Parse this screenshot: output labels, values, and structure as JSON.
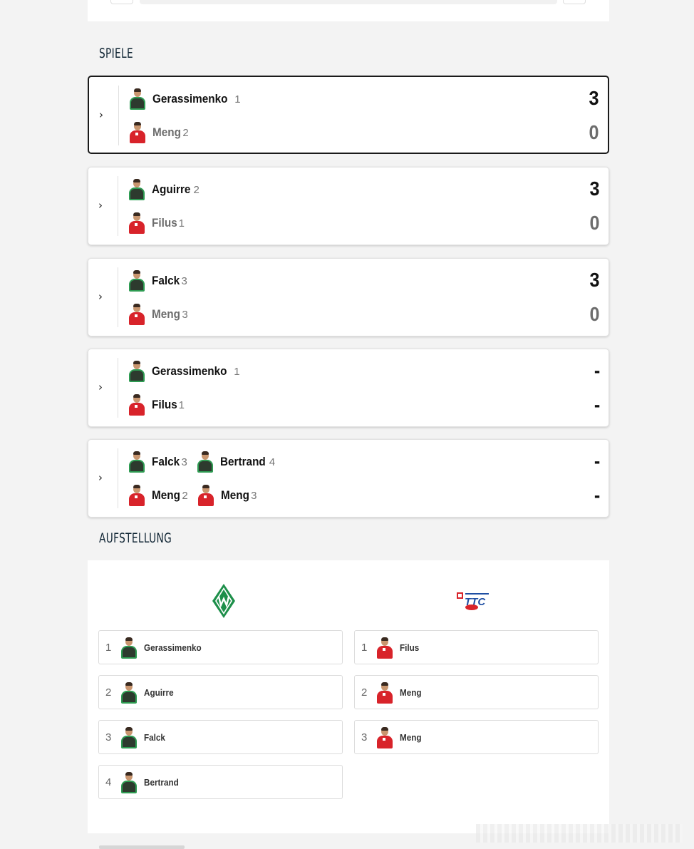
{
  "sections": {
    "spiele_title": "SPIELE",
    "aufstellung_title": "AUFSTELLUNG"
  },
  "matches": [
    {
      "top": {
        "players": [
          {
            "name": "Gerassimenko",
            "pos": "1"
          }
        ],
        "score": "3",
        "winner": true
      },
      "bottom": {
        "players": [
          {
            "name": "Meng",
            "pos": "2"
          }
        ],
        "score": "0",
        "winner": false
      },
      "selected": true
    },
    {
      "top": {
        "players": [
          {
            "name": "Aguirre",
            "pos": "2"
          }
        ],
        "score": "3",
        "winner": true
      },
      "bottom": {
        "players": [
          {
            "name": "Filus",
            "pos": "1"
          }
        ],
        "score": "0",
        "winner": false
      }
    },
    {
      "top": {
        "players": [
          {
            "name": "Falck",
            "pos": "3"
          }
        ],
        "score": "3",
        "winner": true
      },
      "bottom": {
        "players": [
          {
            "name": "Meng",
            "pos": "3"
          }
        ],
        "score": "0",
        "winner": false
      }
    },
    {
      "top": {
        "players": [
          {
            "name": "Gerassimenko",
            "pos": "1"
          }
        ],
        "score": "-",
        "winner": true
      },
      "bottom": {
        "players": [
          {
            "name": "Filus",
            "pos": "1"
          }
        ],
        "score": "-",
        "winner": true
      }
    },
    {
      "top": {
        "players": [
          {
            "name": "Falck",
            "pos": "3"
          },
          {
            "name": "Bertrand",
            "pos": "4"
          }
        ],
        "score": "-",
        "winner": true
      },
      "bottom": {
        "players": [
          {
            "name": "Meng",
            "pos": "2"
          },
          {
            "name": "Meng",
            "pos": "3"
          }
        ],
        "score": "-",
        "winner": true
      }
    }
  ],
  "lineup": {
    "home": [
      {
        "num": "1",
        "name": "Gerassimenko"
      },
      {
        "num": "2",
        "name": "Aguirre"
      },
      {
        "num": "3",
        "name": "Falck"
      },
      {
        "num": "4",
        "name": "Bertrand"
      }
    ],
    "away": [
      {
        "num": "1",
        "name": "Filus"
      },
      {
        "num": "2",
        "name": "Meng"
      },
      {
        "num": "3",
        "name": "Meng"
      }
    ]
  },
  "colors": {
    "home_kit": "#2e9b52",
    "away_kit": "#d8232a",
    "title": "#0f2433"
  }
}
